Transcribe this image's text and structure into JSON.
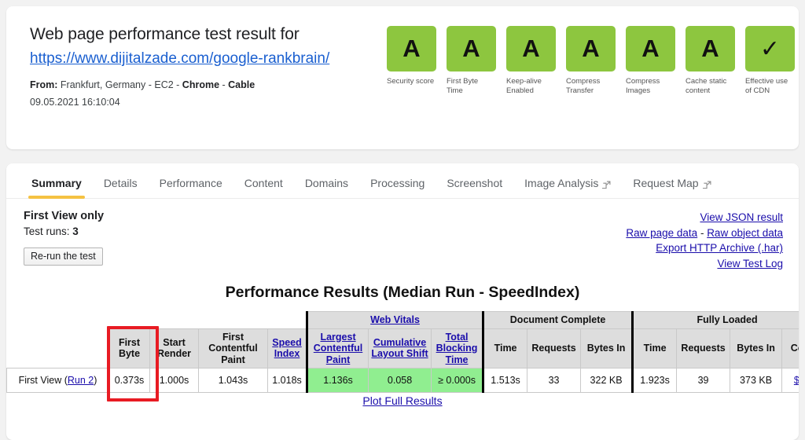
{
  "header": {
    "title": "Web page performance test result for",
    "url": "https://www.dijitalzade.com/google-rankbrain/",
    "from_label": "From:",
    "from_value": " Frankfurt, Germany - EC2 - ",
    "browser": "Chrome",
    "dash1": " - ",
    "connection": "Cable",
    "timestamp": "09.05.2021 16:10:04",
    "grade_color": "#8dc63f",
    "grades": [
      {
        "value": "A",
        "label": "Security score"
      },
      {
        "value": "A",
        "label": "First Byte Time"
      },
      {
        "value": "A",
        "label": "Keep-alive Enabled"
      },
      {
        "value": "A",
        "label": "Compress Transfer"
      },
      {
        "value": "A",
        "label": "Compress Images"
      },
      {
        "value": "A",
        "label": "Cache static content"
      },
      {
        "value": "✓",
        "label": "Effective use of CDN"
      }
    ]
  },
  "tabs": [
    {
      "label": "Summary",
      "active": true,
      "external": false
    },
    {
      "label": "Details",
      "active": false,
      "external": false
    },
    {
      "label": "Performance",
      "active": false,
      "external": false
    },
    {
      "label": "Content",
      "active": false,
      "external": false
    },
    {
      "label": "Domains",
      "active": false,
      "external": false
    },
    {
      "label": "Processing",
      "active": false,
      "external": false
    },
    {
      "label": "Screenshot",
      "active": false,
      "external": false
    },
    {
      "label": "Image Analysis",
      "active": false,
      "external": true
    },
    {
      "label": "Request Map",
      "active": false,
      "external": true
    }
  ],
  "summary": {
    "view_title": "First View only",
    "runs_label": "Test runs:",
    "runs_value": "3",
    "rerun_label": "Re-run the test",
    "links": {
      "view_json": "View JSON result",
      "raw_page": "Raw page data",
      "separator": " - ",
      "raw_object": "Raw object data",
      "export_har": "Export HTTP Archive (.har)",
      "view_log": "View Test Log"
    }
  },
  "results": {
    "title": "Performance Results (Median Run - SpeedIndex)",
    "group_headers": {
      "web_vitals": "Web Vitals",
      "document_complete": "Document Complete",
      "fully_loaded": "Fully Loaded"
    },
    "columns": [
      "First Byte",
      "Start Render",
      "First Contentful Paint",
      "Speed Index",
      "Largest Contentful Paint",
      "Cumulative Layout Shift",
      "Total Blocking Time",
      "Time",
      "Requests",
      "Bytes In",
      "Time",
      "Requests",
      "Bytes In",
      "Cost"
    ],
    "rows": [
      {
        "label": "First View (",
        "run_link": "Run 2",
        "label_end": ")",
        "cells": [
          {
            "value": "0.373s",
            "green": false
          },
          {
            "value": "1.000s",
            "green": false
          },
          {
            "value": "1.043s",
            "green": false
          },
          {
            "value": "1.018s",
            "green": false
          },
          {
            "value": "1.136s",
            "green": true
          },
          {
            "value": "0.058",
            "green": true
          },
          {
            "value": "≥ 0.000s",
            "green": true
          },
          {
            "value": "1.513s",
            "green": false
          },
          {
            "value": "33",
            "green": false
          },
          {
            "value": "322 KB",
            "green": false
          },
          {
            "value": "1.923s",
            "green": false
          },
          {
            "value": "39",
            "green": false
          },
          {
            "value": "373 KB",
            "green": false
          },
          {
            "value": "$—",
            "green": false
          }
        ]
      }
    ],
    "plot_link": "Plot Full Results",
    "highlight_color": "#e81b23",
    "green_color": "#90ee90"
  }
}
